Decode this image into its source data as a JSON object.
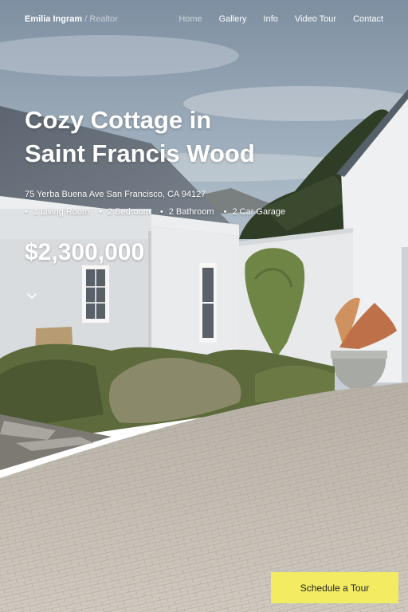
{
  "header": {
    "brand_name": "Emilia Ingram",
    "brand_separator": "/",
    "brand_role": "Realtor",
    "nav": [
      {
        "label": "Home",
        "active": true
      },
      {
        "label": "Gallery"
      },
      {
        "label": "Info"
      },
      {
        "label": "Video Tour"
      },
      {
        "label": "Contact"
      }
    ]
  },
  "hero": {
    "title_line1": "Cozy Cottage in",
    "title_line2": "Saint Francis Wood",
    "address": "75 Yerba Buena Ave San Francisco, CA 94127",
    "features": [
      "1 Living Room",
      "2 Bedroom",
      "2 Bathroom",
      "2 Car Garage"
    ],
    "price": "$2,300,000",
    "scroll_icon": "chevron-down-icon"
  },
  "cta": {
    "label": "Schedule a Tour",
    "color": "#f3ec62"
  },
  "background": {
    "image": "white cottage with grey tin roof, hedges, pine tree, mountain and brick-paved driveway"
  }
}
